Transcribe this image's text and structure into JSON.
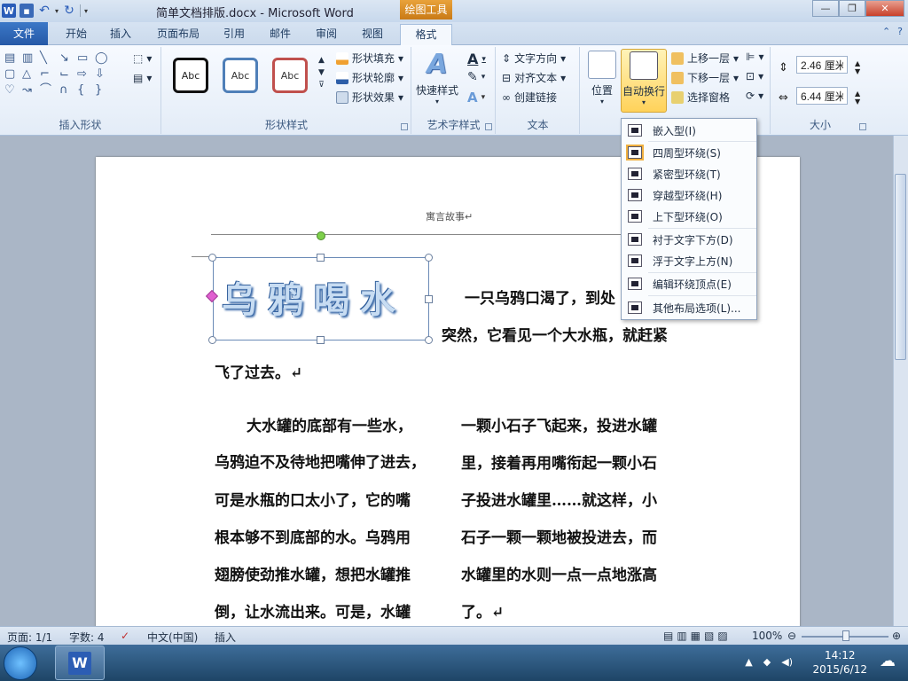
{
  "window": {
    "title": "简单文档排版.docx - Microsoft Word",
    "context_tab_header": "绘图工具"
  },
  "tabs": [
    {
      "label": "文件"
    },
    {
      "label": "开始"
    },
    {
      "label": "插入"
    },
    {
      "label": "页面布局"
    },
    {
      "label": "引用"
    },
    {
      "label": "邮件"
    },
    {
      "label": "审阅"
    },
    {
      "label": "视图"
    },
    {
      "label": "格式"
    }
  ],
  "ribbon": {
    "groups": {
      "insert_shapes": "插入形状",
      "shape_styles": "形状样式",
      "wordart_styles": "艺术字样式",
      "text": "文本",
      "size": "大小"
    },
    "style_samples": [
      "Abc",
      "Abc",
      "Abc"
    ],
    "shape_fill": "形状填充",
    "shape_outline": "形状轮廓",
    "shape_effects": "形状效果",
    "quick_styles": "快速样式",
    "text_direction": "文字方向",
    "align_text": "对齐文本",
    "create_link": "创建链接",
    "position": "位置",
    "wrap_text": "自动换行",
    "bring_forward": "上移一层",
    "send_backward": "下移一层",
    "selection_pane": "选择窗格",
    "height": "2.46 厘米",
    "width": "6.44 厘米"
  },
  "wrap_menu": [
    {
      "label": "嵌入型(I)"
    },
    {
      "label": "四周型环绕(S)"
    },
    {
      "label": "紧密型环绕(T)"
    },
    {
      "label": "穿越型环绕(H)"
    },
    {
      "label": "上下型环绕(O)"
    },
    {
      "label": "衬于文字下方(D)"
    },
    {
      "label": "浮于文字上方(N)"
    },
    {
      "label": "编辑环绕顶点(E)"
    },
    {
      "label": "其他布局选项(L)..."
    }
  ],
  "document": {
    "header": "寓言故事↵",
    "wordart": "乌鸦喝水",
    "lines": [
      "一只乌鸦口渴了，到处",
      "突然，它看见一个大水瓶，就赶紧",
      "飞了过去。↵",
      "大水罐的底部有一些水，",
      "乌鸦迫不及待地把嘴伸了进去，",
      "可是水瓶的口太小了，它的嘴",
      "根本够不到底部的水。乌鸦用",
      "翅膀使劲推水罐，想把水罐推",
      "倒，让水流出来。可是，水罐",
      "一颗小石子飞起来，投进水罐",
      "里，接着再用嘴衔起一颗小石",
      "子投进水罐里……就这样，小",
      "石子一颗一颗地被投进去，而",
      "水罐里的水则一点一点地涨高",
      "了。↵"
    ]
  },
  "status": {
    "page": "页面: 1/1",
    "words": "字数: 4",
    "language": "中文(中国)",
    "mode": "插入",
    "zoom": "100%"
  },
  "taskbar": {
    "time": "14:12",
    "date": "2015/6/12"
  }
}
